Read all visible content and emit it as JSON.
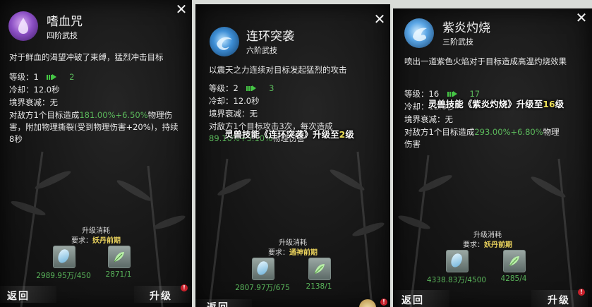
{
  "panels": [
    {
      "name": "嗜血咒",
      "rank": "四阶武技",
      "description": "对于鲜血的渴望冲破了束缚，猛烈冲击目标",
      "level_label": "等级：",
      "level_current": "1",
      "level_next": "2",
      "cooldown": "冷却：12.0秒",
      "decay": "境界衰减：无",
      "effect_prefix": "对敌方1个目标造成",
      "effect_value": "181.00%+6.50%",
      "effect_suffix": "物理伤害，附加物理撕裂(受到物理伤害+20%)，持续8秒",
      "cost_title": "升级消耗",
      "req_label": "要求：",
      "req_value": "妖丹前期",
      "item1_count": "2989.95万/450",
      "item2_count": "2871/1",
      "back": "返回",
      "upgrade": "升级",
      "badge": "!"
    },
    {
      "name": "连环突袭",
      "rank": "六阶武技",
      "description": "以震天之力连续对目标发起猛烈的攻击",
      "level_label": "等级：",
      "level_current": "2",
      "level_next": "3",
      "cooldown": "冷却：12.0秒",
      "decay": "境界衰减：无",
      "effect_prefix": "对敌方1个目标攻击3次，每次造成",
      "effect_value": "89.10%+3.10%",
      "effect_suffix": "物理伤害",
      "overlay_pre": "灵兽技能《连环突袭》升级至",
      "overlay_num": "2",
      "overlay_post": "级",
      "cost_title": "升级消耗",
      "req_label": "要求：",
      "req_value": "通神前期",
      "item1_count": "2807.97万/675",
      "item2_count": "2138/1",
      "back": "返回",
      "badge": "!"
    },
    {
      "name": "紫炎灼烧",
      "rank": "三阶武技",
      "description": "喷出一道紫色火焰对于目标造成高温灼烧效果",
      "level_label": "等级：",
      "level_current": "16",
      "level_next": "17",
      "cooldown": "冷却：12.0秒",
      "decay": "境界衰减：无",
      "effect_prefix": "对敌方1个目标造成",
      "effect_value": "293.00%+6.80%",
      "effect_suffix": "物理伤害",
      "overlay_pre": "灵兽技能《紫炎灼烧》升级至",
      "overlay_num": "16",
      "overlay_post": "级",
      "cost_title": "升级消耗",
      "req_label": "要求：",
      "req_value": "妖丹前期",
      "item1_count": "4338.83万/4500",
      "item2_count": "4285/4",
      "back": "返回",
      "upgrade": "升级",
      "badge": "!"
    }
  ],
  "colors": {
    "accent_green": "#5bb85b",
    "req_gold": "#e9d15c",
    "badge_red": "#c8202b"
  },
  "icons": [
    "close-icon",
    "blood-drop-icon",
    "water-orb-icon",
    "flame-orb-icon",
    "spirit-gem-icon",
    "herb-leaf-icon",
    "arrow-right-icon"
  ]
}
